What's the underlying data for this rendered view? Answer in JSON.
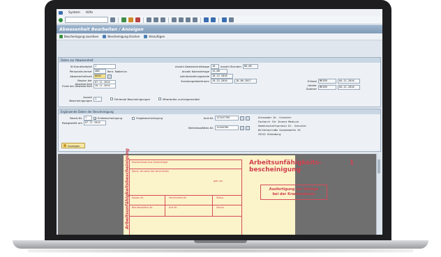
{
  "menu": [
    "System",
    "Hilfe"
  ],
  "title": "Abwesenheit Bearbeiten / Anzeigen",
  "app_toolbar": [
    "Bescheinigung zuordnen",
    "Bescheinigung löschen",
    "Hinzufügen"
  ],
  "group1": {
    "title": "Daten zur Abwesenheit",
    "fields": {
      "id_krankheitsfall": {
        "label": "ID Krankheitsfall",
        "value": "1"
      },
      "personalnummer": {
        "label": "Personalnummer",
        "value": "400",
        "name": "Hans Rabbeins"
      },
      "abwesenheitsart": {
        "label": "Abwesenheitsart",
        "value": "0020"
      },
      "beginn": {
        "label": "Beginn der Abwesenheit",
        "value": "07.11.2016"
      },
      "ende": {
        "label": "Ende der Abwesenheit",
        "value": "20.11.2016"
      },
      "anzahl_kalendertage": {
        "label": "Anzahl Abwesenheitstage",
        "value": "10",
        "extra_label": "Anzahl Stunden",
        "extra_value": "80,00"
      },
      "kalendertage": {
        "label": "Anzahl Kalendertage",
        "value": "14,00"
      },
      "lohnfortzahlung": {
        "label": "Lohnfortzahlungsende",
        "value": "18.12.2016"
      },
      "krankengeld": {
        "label": "Krankengeldzeitraum",
        "value_from": "19.12.2016",
        "value_to": "16.06.2017"
      },
      "erfasst": {
        "label": "Erfasst",
        "user": "MEIER",
        "date": "04.11.2016"
      },
      "letzter_aenderer": {
        "label": "Letzter Änderer",
        "user": "MEIER",
        "date": "04.11.2016"
      },
      "anzahl_bescheinigungen": {
        "label": "Anzahl Bescheinigungen",
        "value": "1"
      },
      "fehlende": "Fehlende Bescheinigungen",
      "mitarbeiter": "Mitarbeiter zurückgemeldet"
    }
  },
  "group2": {
    "title": "Ergänzende Daten der Bescheinigung",
    "bearb_label": "Bearb.Nr.",
    "bearb_value": "1",
    "erstbescheinigung": "Erstbescheinigung",
    "folgebescheinigung": "Folgebescheinigung",
    "postgestellt_label": "Postgestellt am",
    "postgestellt_value": "07.11.2016",
    "arzt_label": "Arzt-Nr.",
    "arzt_value": "123457789",
    "arzt_name": [
      "Alexander Dr. Schuster",
      "Facharzt für Innere Medizin"
    ],
    "betrieb_label": "Betriebsstätten-Nr.",
    "betrieb_value": "12456789",
    "praxis": [
      "Gemeinschaftspraxis Dr. Schuster",
      "Wilhelmstraße Sonnenmatte 43",
      "29122     Oldenburg"
    ],
    "button": "Anzeigen"
  },
  "doc": {
    "side_text": "Arbeitsunfähigkeitsbescheinigung",
    "left_labels": [
      "Krankenkasse bzw. Kostenträger",
      "Name, Vorname des Versicherten",
      "geb. am",
      "Kassen-Nr.",
      "Versicherten-Nr.",
      "Status",
      "Betriebsstätten-Nr.",
      "Arzt-Nr.",
      "Datum"
    ],
    "title": "Arbeitsunfähigkeits-\nbescheinigung",
    "number": "1",
    "box": "Ausfertigung zur Vorlage\nbei der Krankenkasse"
  }
}
